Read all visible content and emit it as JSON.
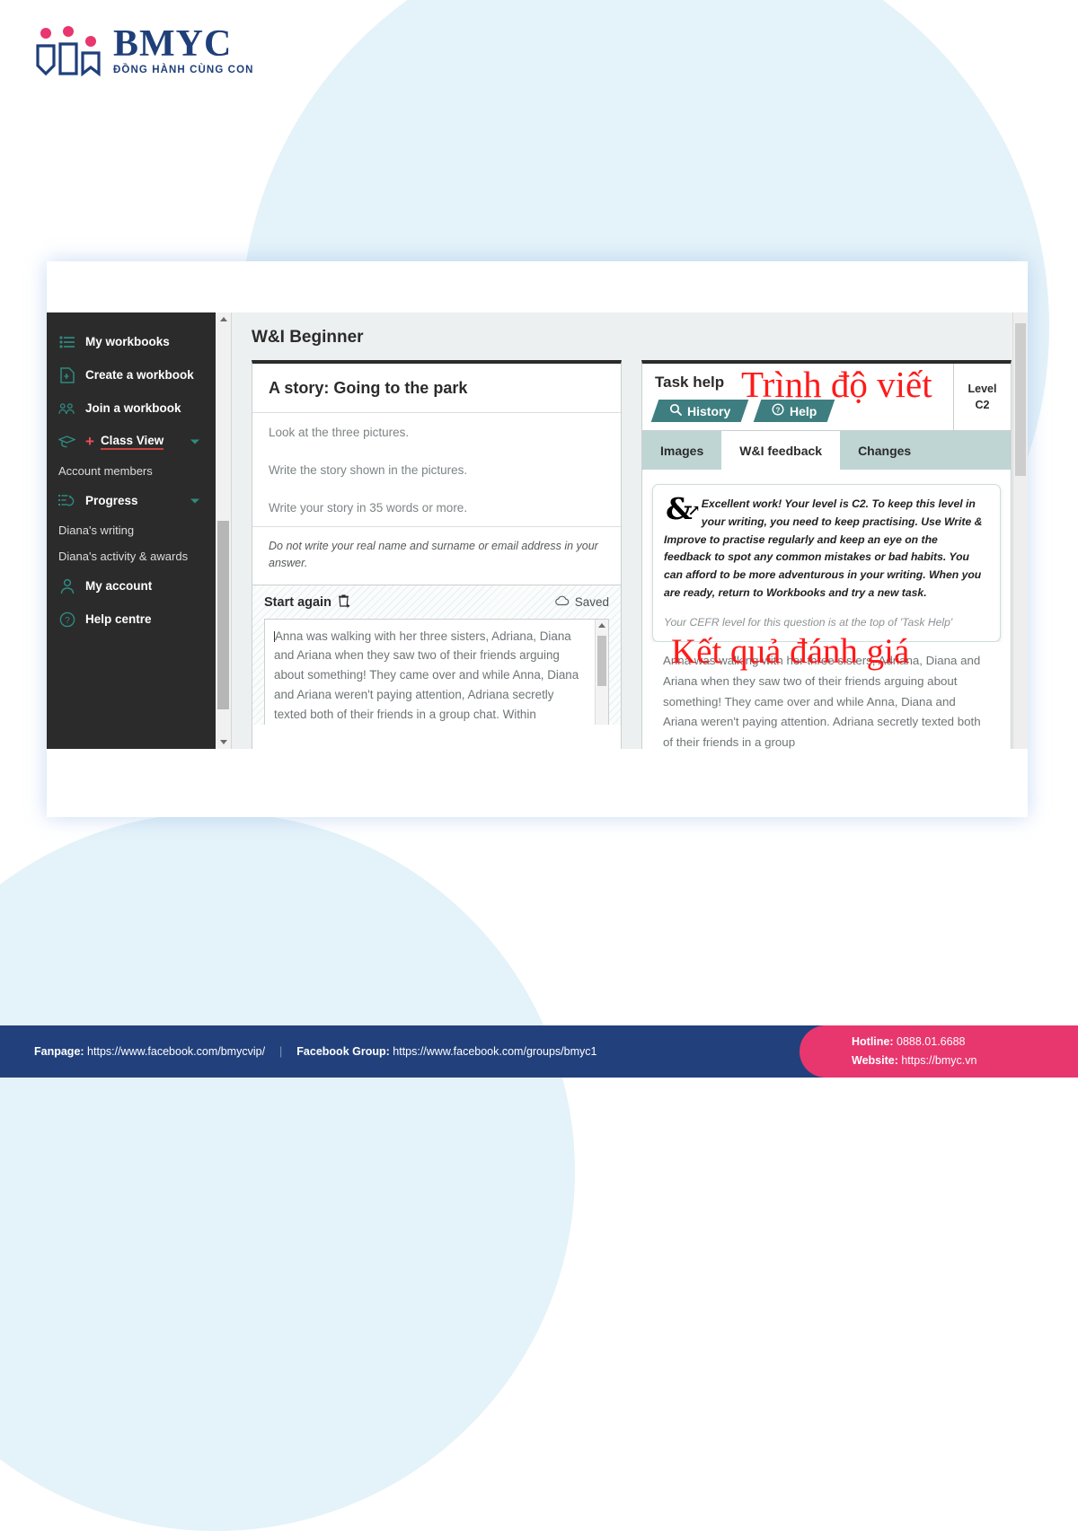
{
  "brand": {
    "name": "BMYC",
    "tagline": "ĐỒNG HÀNH CÙNG CON"
  },
  "sidebar": {
    "items": [
      {
        "label": "My workbooks",
        "icon": "list-icon",
        "type": "main"
      },
      {
        "label": "Create a workbook",
        "icon": "file-plus-icon",
        "type": "main"
      },
      {
        "label": "Join a workbook",
        "icon": "group-icon",
        "type": "main"
      },
      {
        "label": "Class View",
        "icon": "graduation-cap-icon",
        "type": "main",
        "plus": "+",
        "expandable": true,
        "active": true
      },
      {
        "label": "Account members",
        "type": "sub"
      },
      {
        "label": "Progress",
        "icon": "progress-icon",
        "type": "main",
        "expandable": true
      },
      {
        "label": "Diana's writing",
        "type": "sub"
      },
      {
        "label": "Diana's activity & awards",
        "type": "sub"
      },
      {
        "label": "My account",
        "icon": "user-icon",
        "type": "main"
      },
      {
        "label": "Help centre",
        "icon": "question-circle-icon",
        "type": "main"
      }
    ]
  },
  "main": {
    "page_title": "W&I Beginner"
  },
  "task": {
    "title": "A story: Going to the park",
    "instructions": [
      "Look at the three pictures.",
      "Write the story shown in the pictures.",
      "Write your story in 35 words or more."
    ],
    "note": "Do not write your real name and surname or email address in your answer.",
    "start_again_label": "Start again",
    "start_again_icon": "trash-icon",
    "saved_label": "Saved",
    "saved_icon": "cloud-icon",
    "answer_text": "Anna was walking with her three sisters, Adriana, Diana and Ariana when they saw two of their friends arguing about something! They came over and while Anna, Diana and Ariana weren't paying attention, Adriana secretly texted both of their friends in a group chat. Within seconds, they both"
  },
  "help": {
    "title": "Task help",
    "buttons": [
      {
        "label": "History",
        "icon": "search-icon"
      },
      {
        "label": "Help",
        "icon": "question-circle-icon"
      }
    ],
    "level_label": "Level",
    "level_value": "C2",
    "tabs": [
      {
        "label": "Images",
        "active": false
      },
      {
        "label": "W&I feedback",
        "active": true
      },
      {
        "label": "Changes",
        "active": false
      }
    ],
    "feedback_icon": "ampersand-arrow-icon",
    "feedback_text": "Excellent work! Your level is C2. To keep this level in your writing, you need to keep practising. Use Write & Improve to practise regularly and keep an eye on the feedback to spot any common mistakes or bad habits. You can afford to be more adventurous in your writing. When you are ready, return to Workbooks and try a new task.",
    "feedback_note": "Your CEFR level for this question is at the top of 'Task Help'",
    "essay_text": "Anna was walking with her three sisters, Adriana, Diana and Ariana when they saw two of their friends arguing about something! They came over and while Anna, Diana and Ariana weren't paying atten­tion. Adriana secretly texted both of their friends in a group"
  },
  "annotations": {
    "level_note": "Trình độ viết",
    "result_note": "Kết quả đánh giá",
    "color": "#ff1a1a"
  },
  "footer": {
    "fanpage_label": "Fanpage:",
    "fanpage_url": "https://www.facebook.com/bmycvip/",
    "group_label": "Facebook Group:",
    "group_url": "https://www.facebook.com/groups/bmyc1",
    "hotline_label": "Hotline:",
    "hotline_value": "0888.01.6688",
    "website_label": "Website:",
    "website_value": "https://bmyc.vn",
    "bg_color": "#22417c",
    "accent_color": "#e8366f"
  }
}
